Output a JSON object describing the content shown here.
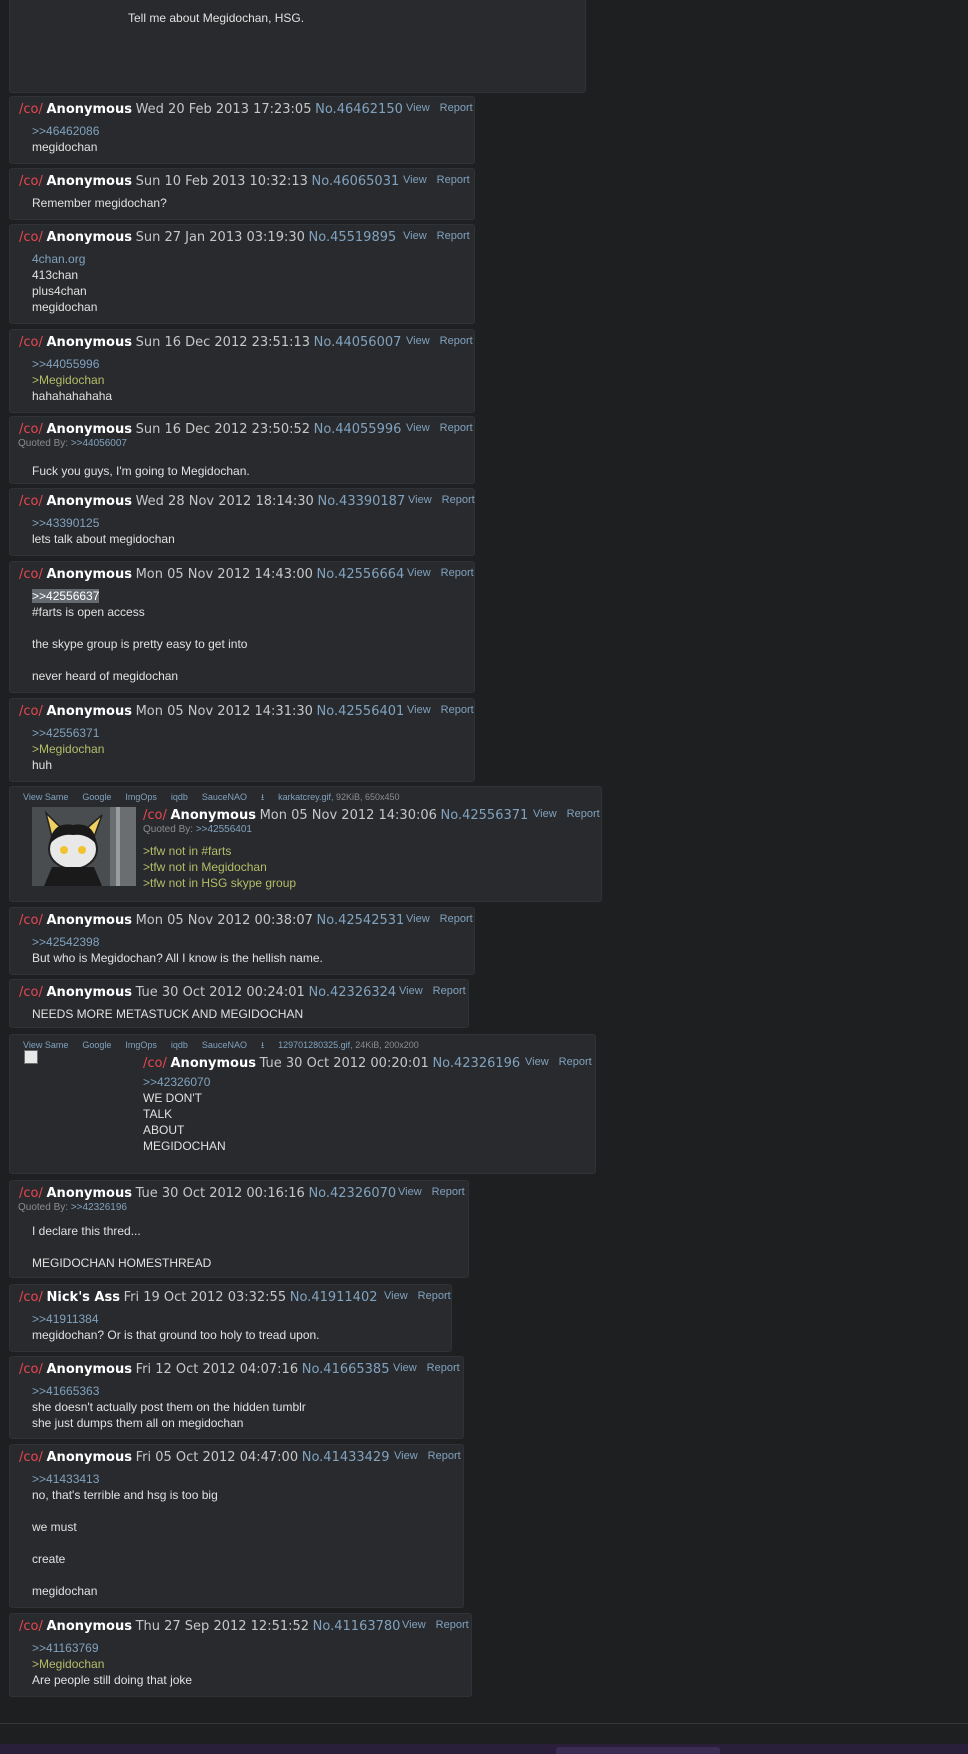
{
  "op": {
    "text": "Tell me about Megidochan, HSG."
  },
  "actions": {
    "view": "View",
    "report": "Report"
  },
  "quoted_by_label": "Quoted By:",
  "image_tools": [
    "View Same",
    "Google",
    "ImgOps",
    "iqdb",
    "SauceNAO"
  ],
  "posts": [
    {
      "board": "/co/",
      "name": "Anonymous",
      "date": "Wed 20 Feb 2013 17:23:05",
      "no": "No.46462150",
      "lines": [
        {
          "t": ">>46462086",
          "c": "lnk"
        },
        {
          "t": "megidochan"
        }
      ]
    },
    {
      "board": "/co/",
      "name": "Anonymous",
      "date": "Sun 10 Feb 2013 10:32:13",
      "no": "No.46065031",
      "lines": [
        {
          "t": "Remember megidochan?"
        }
      ]
    },
    {
      "board": "/co/",
      "name": "Anonymous",
      "date": "Sun 27 Jan 2013 03:19:30",
      "no": "No.45519895",
      "lines": [
        {
          "t": "4chan.org",
          "c": "lnk"
        },
        {
          "t": "413chan"
        },
        {
          "t": "plus4chan"
        },
        {
          "t": "megidochan"
        }
      ]
    },
    {
      "board": "/co/",
      "name": "Anonymous",
      "date": "Sun 16 Dec 2012 23:51:13",
      "no": "No.44056007",
      "lines": [
        {
          "t": ">>44055996",
          "c": "lnk"
        },
        {
          "t": ">Megidochan",
          "c": "grn"
        },
        {
          "t": "hahahahahaha"
        }
      ]
    },
    {
      "board": "/co/",
      "name": "Anonymous",
      "date": "Sun 16 Dec 2012 23:50:52",
      "no": "No.44055996",
      "quoted_by": ">>44056007",
      "lines": [
        {
          "t": "Fuck you guys, I'm going to Megidochan."
        }
      ]
    },
    {
      "board": "/co/",
      "name": "Anonymous",
      "date": "Wed 28 Nov 2012 18:14:30",
      "no": "No.43390187",
      "lines": [
        {
          "t": ">>43390125",
          "c": "lnk"
        },
        {
          "t": "lets talk about megidochan"
        }
      ]
    },
    {
      "board": "/co/",
      "name": "Anonymous",
      "date": "Mon 05 Nov 2012 14:43:00",
      "no": "No.42556664",
      "lines": [
        {
          "t": ">>42556637",
          "c": "hl"
        },
        {
          "t": "#farts is open access"
        },
        {
          "t": ""
        },
        {
          "t": "the skype group is pretty easy to get into"
        },
        {
          "t": ""
        },
        {
          "t": "never heard of megidochan"
        }
      ]
    },
    {
      "board": "/co/",
      "name": "Anonymous",
      "date": "Mon 05 Nov 2012 14:31:30",
      "no": "No.42556401",
      "lines": [
        {
          "t": ">>42556371",
          "c": "lnk"
        },
        {
          "t": ">Megidochan",
          "c": "grn"
        },
        {
          "t": "huh"
        }
      ]
    },
    {
      "board": "/co/",
      "name": "Anonymous",
      "date": "Mon 05 Nov 2012 14:30:06",
      "no": "No.42556371",
      "file": "karkatcrey.gif",
      "file_meta": ", 92KiB, 650x450",
      "quoted_by": ">>42556401",
      "lines": [
        {
          "t": ">tfw not in #farts",
          "c": "grn"
        },
        {
          "t": ">tfw not in Megidochan",
          "c": "grn"
        },
        {
          "t": ">tfw not in HSG skype group",
          "c": "grn"
        }
      ]
    },
    {
      "board": "/co/",
      "name": "Anonymous",
      "date": "Mon 05 Nov 2012 00:38:07",
      "no": "No.42542531",
      "lines": [
        {
          "t": ">>42542398",
          "c": "lnk"
        },
        {
          "t": "But who is Megidochan? All I know is the hellish name."
        }
      ]
    },
    {
      "board": "/co/",
      "name": "Anonymous",
      "date": "Tue 30 Oct 2012 00:24:01",
      "no": "No.42326324",
      "lines": [
        {
          "t": "NEEDS MORE METASTUCK AND MEGIDOCHAN"
        }
      ]
    },
    {
      "board": "/co/",
      "name": "Anonymous",
      "date": "Tue 30 Oct 2012 00:20:01",
      "no": "No.42326196",
      "file": "129701280325.gif",
      "file_meta": ", 24KiB, 200x200",
      "lines": [
        {
          "t": ">>42326070",
          "c": "lnk"
        },
        {
          "t": "WE DON'T"
        },
        {
          "t": "TALK"
        },
        {
          "t": "ABOUT"
        },
        {
          "t": "MEGIDOCHAN"
        }
      ]
    },
    {
      "board": "/co/",
      "name": "Anonymous",
      "date": "Tue 30 Oct 2012 00:16:16",
      "no": "No.42326070",
      "quoted_by": ">>42326196",
      "lines": [
        {
          "t": "I declare this thred..."
        },
        {
          "t": ""
        },
        {
          "t": "MEGIDOCHAN HOMESTHREAD"
        }
      ]
    },
    {
      "board": "/co/",
      "name": "Nick's Ass",
      "date": "Fri 19 Oct 2012 03:32:55",
      "no": "No.41911402",
      "lines": [
        {
          "t": ">>41911384",
          "c": "lnk"
        },
        {
          "t": "megidochan? Or is that ground too holy to tread upon."
        }
      ]
    },
    {
      "board": "/co/",
      "name": "Anonymous",
      "date": "Fri 12 Oct 2012 04:07:16",
      "no": "No.41665385",
      "lines": [
        {
          "t": ">>41665363",
          "c": "lnk"
        },
        {
          "t": "she doesn't actually post them on the hidden tumblr"
        },
        {
          "t": "she just dumps them all on megidochan"
        }
      ]
    },
    {
      "board": "/co/",
      "name": "Anonymous",
      "date": "Fri 05 Oct 2012 04:47:00",
      "no": "No.41433429",
      "lines": [
        {
          "t": ">>41433413",
          "c": "lnk"
        },
        {
          "t": "no, that's terrible and hsg is too big"
        },
        {
          "t": ""
        },
        {
          "t": "we must"
        },
        {
          "t": ""
        },
        {
          "t": "create"
        },
        {
          "t": ""
        },
        {
          "t": "megidochan"
        }
      ]
    },
    {
      "board": "/co/",
      "name": "Anonymous",
      "date": "Thu 27 Sep 2012 12:51:52",
      "no": "No.41163780",
      "lines": [
        {
          "t": ">>41163769",
          "c": "lnk"
        },
        {
          "t": ">Megidochan",
          "c": "grn"
        },
        {
          "t": "Are people still doing that joke"
        }
      ]
    }
  ]
}
